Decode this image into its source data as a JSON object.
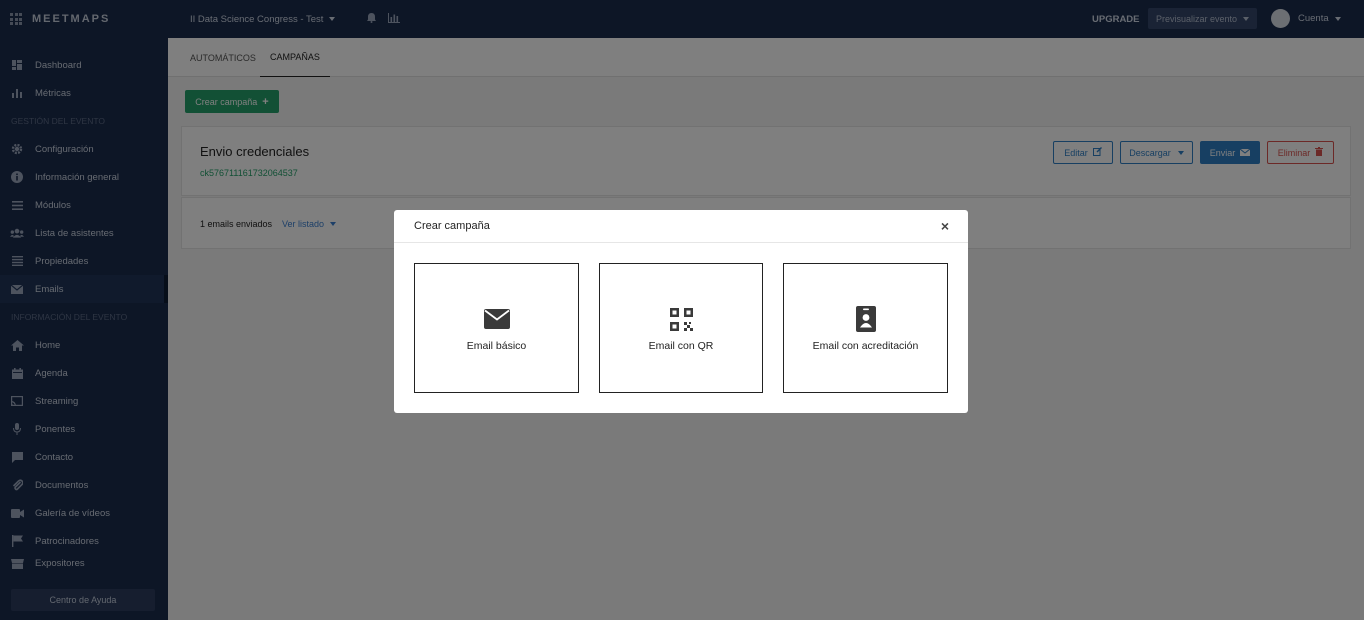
{
  "app": {
    "logo": "MEETMAPS"
  },
  "sidebar": {
    "top_items": [
      {
        "label": "Dashboard",
        "icon": "dashboard-icon"
      },
      {
        "label": "Métricas",
        "icon": "bar-chart-icon"
      }
    ],
    "section_event_management": "GESTIÓN DEL EVENTO",
    "management_items": [
      {
        "label": "Configuración",
        "icon": "gear-icon"
      },
      {
        "label": "Información general",
        "icon": "info-icon"
      },
      {
        "label": "Módulos",
        "icon": "list-icon"
      },
      {
        "label": "Lista de asistentes",
        "icon": "users-icon"
      },
      {
        "label": "Propiedades",
        "icon": "properties-icon"
      },
      {
        "label": "Emails",
        "icon": "envelope-icon"
      }
    ],
    "section_event_info": "INFORMACIÓN DEL EVENTO",
    "info_items": [
      {
        "label": "Home",
        "icon": "home-icon"
      },
      {
        "label": "Agenda",
        "icon": "calendar-icon"
      },
      {
        "label": "Streaming",
        "icon": "cast-icon"
      },
      {
        "label": "Ponentes",
        "icon": "microphone-icon"
      },
      {
        "label": "Contacto",
        "icon": "chat-icon"
      },
      {
        "label": "Documentos",
        "icon": "paperclip-icon"
      },
      {
        "label": "Galería de vídeos",
        "icon": "video-icon"
      },
      {
        "label": "Patrocinadores",
        "icon": "flag-icon"
      },
      {
        "label": "Expositores",
        "icon": "store-icon"
      }
    ],
    "help_button": "Centro de Ayuda"
  },
  "topbar": {
    "event_name": "II Data Science Congress - Test",
    "upgrade": "UPGRADE",
    "preview": "Previsualizar evento",
    "account": "Cuenta"
  },
  "tabs": [
    {
      "label": "AUTOMÁTICOS"
    },
    {
      "label": "CAMPAÑAS"
    }
  ],
  "create_button": "Crear campaña",
  "campaign": {
    "title": "Envio credenciales",
    "id": "ck576711161732064537",
    "edit": "Editar",
    "download": "Descargar",
    "send": "Enviar",
    "delete": "Eliminar",
    "sent_count": "1 emails enviados",
    "view_list": "Ver listado"
  },
  "modal": {
    "title": "Crear campaña",
    "options": [
      {
        "label": "Email básico",
        "icon": "envelope-icon"
      },
      {
        "label": "Email con QR",
        "icon": "qr-code-icon"
      },
      {
        "label": "Email con acreditación",
        "icon": "id-badge-icon"
      }
    ]
  },
  "colors": {
    "sidebar_bg": "#1a2c4d",
    "accent_green": "#24a06a",
    "accent_blue": "#2f7fc5",
    "danger_red": "#d9534f"
  }
}
